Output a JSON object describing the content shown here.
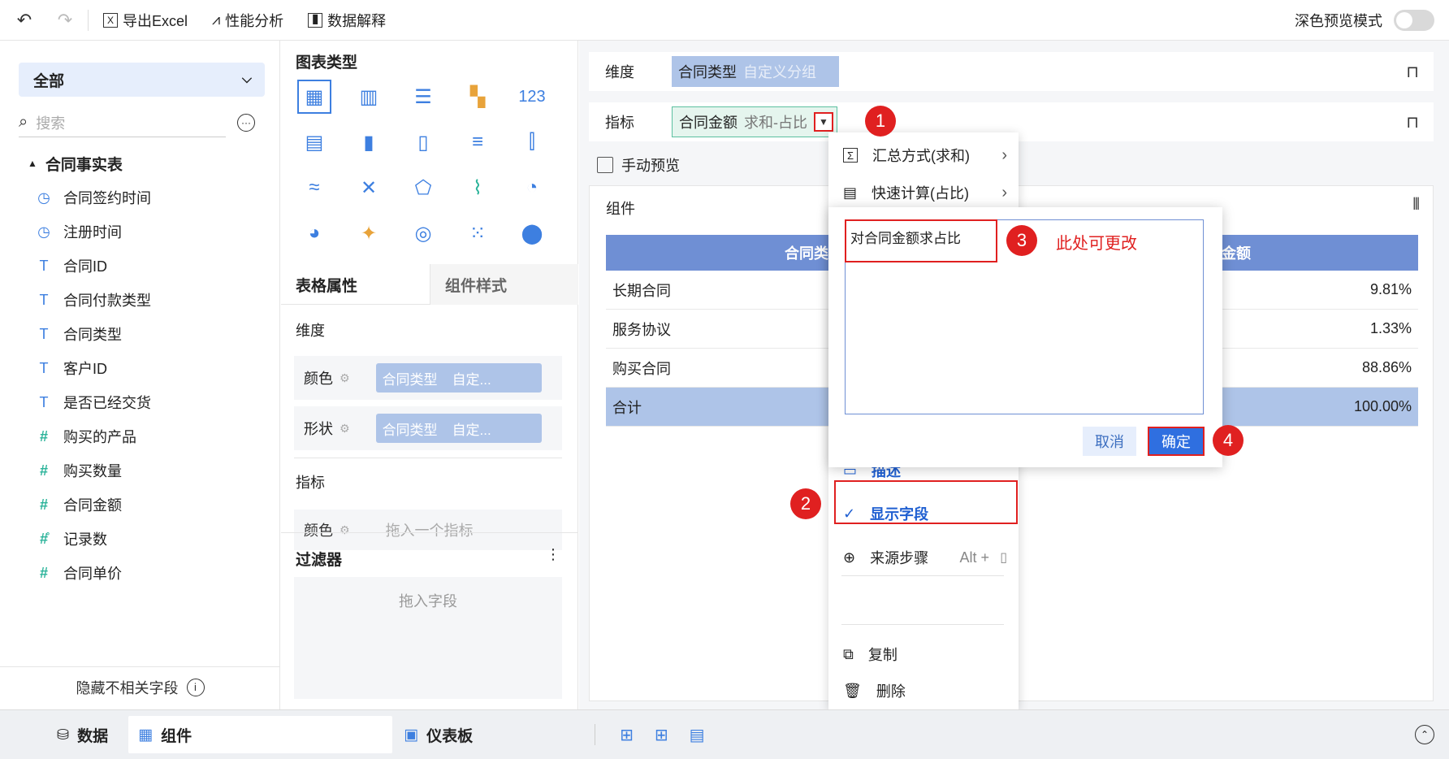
{
  "toolbar": {
    "export_excel": "导出Excel",
    "perf_analysis": "性能分析",
    "data_explain": "数据解释",
    "dark_preview": "深色预览模式"
  },
  "left": {
    "select_label": "全部",
    "search_placeholder": "搜索",
    "table_name": "合同事实表",
    "fields": [
      {
        "label": "合同签约时间",
        "type": "date"
      },
      {
        "label": "注册时间",
        "type": "date"
      },
      {
        "label": "合同ID",
        "type": "text"
      },
      {
        "label": "合同付款类型",
        "type": "text"
      },
      {
        "label": "合同类型",
        "type": "text"
      },
      {
        "label": "客户ID",
        "type": "text"
      },
      {
        "label": "是否已经交货",
        "type": "text"
      },
      {
        "label": "购买的产品",
        "type": "number"
      },
      {
        "label": "购买数量",
        "type": "number"
      },
      {
        "label": "合同金额",
        "type": "number"
      },
      {
        "label": "记录数",
        "type": "number-count"
      },
      {
        "label": "合同单价",
        "type": "number-calc"
      }
    ],
    "hide_unrelated": "隐藏不相关字段"
  },
  "middle": {
    "chart_type_title": "图表类型",
    "tab_table_props": "表格属性",
    "tab_comp_style": "组件样式",
    "dim_label": "维度",
    "color_label": "颜色",
    "shape_label": "形状",
    "chip_field": "合同类型",
    "chip_group": "自定...",
    "indicator_label": "指标",
    "drag_indicator": "拖入一个指标",
    "filter_title": "过滤器",
    "drag_field": "拖入字段"
  },
  "right": {
    "dim_label": "维度",
    "dim_chip_field": "合同类型",
    "dim_chip_group": "自定义分组",
    "ind_label": "指标",
    "ind_chip_field": "合同金额",
    "ind_chip_agg": "求和-占比",
    "manual_preview": "手动预览",
    "component_label": "组件",
    "table_header_1": "合同类型",
    "table_header_2": "合同金额",
    "rows": [
      {
        "name": "长期合同",
        "value": "9.81%"
      },
      {
        "name": "服务协议",
        "value": "1.33%"
      },
      {
        "name": "购买合同",
        "value": "88.86%"
      }
    ],
    "total_label": "合计",
    "total_value": "100.00%"
  },
  "menu": {
    "agg": "汇总方式(求和)",
    "quick_calc": "快速计算(占比)",
    "describe": "描述",
    "show_field": "显示字段",
    "source_step": "来源步骤",
    "source_shortcut": "Alt +",
    "copy": "复制",
    "delete": "删除"
  },
  "dialog": {
    "text": "对合同金额求占比",
    "cancel": "取消",
    "confirm": "确定"
  },
  "annotations": {
    "n1": "1",
    "n2": "2",
    "n3": "3",
    "n4": "4",
    "note": "此处可更改"
  },
  "bottom": {
    "data": "数据",
    "component": "组件",
    "dashboard": "仪表板"
  }
}
